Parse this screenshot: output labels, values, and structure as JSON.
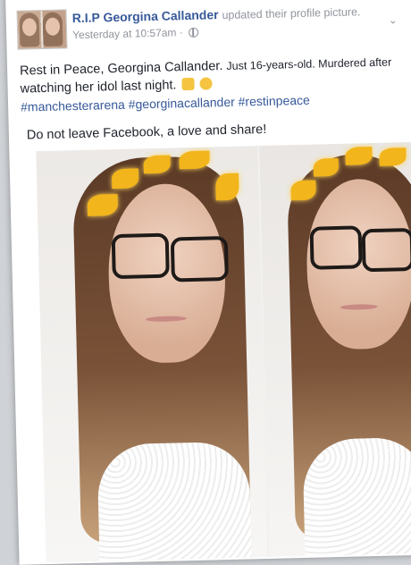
{
  "post": {
    "page_name": "R.I.P Georgina Callander",
    "action": "updated their profile picture.",
    "timestamp": "Yesterday at 10:57am",
    "separator": "·",
    "line1_main": "Rest in Peace, Georgina Callander.",
    "line1_small": "Just 16-years-old. Murdered after",
    "line2": "watching her idol last night.",
    "hashtags": "#manchesterarena #georginacallander #restinpeace",
    "line3": "Do not leave Facebook, a love and share!",
    "options_glyph": "⌄"
  },
  "icons": [
    "avatar",
    "globe-icon",
    "chevron-down-icon",
    "praying-hands-emoji",
    "crying-face-emoji"
  ],
  "colors": {
    "link": "#365899",
    "meta": "#90949c",
    "text": "#1d2129",
    "background": "#ffffff"
  }
}
